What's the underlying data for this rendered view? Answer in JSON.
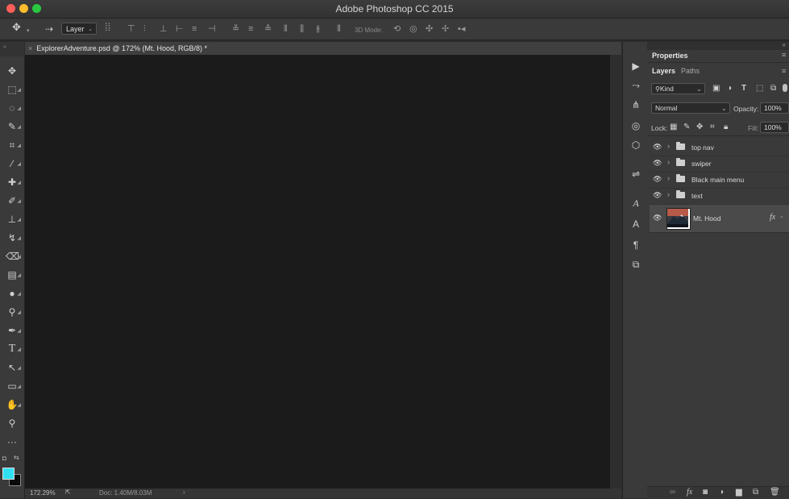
{
  "window": {
    "title": "Adobe Photoshop CC 2015",
    "traffic_colors": [
      "#fc5f57",
      "#fdbc2e",
      "#29c840"
    ]
  },
  "options_bar": {
    "move_icon": "move-tool-icon",
    "target_select": "Layer",
    "mode_label": "3D Mode:"
  },
  "document": {
    "tab_title": "ExplorerAdventure.psd @ 172% (Mt. Hood, RGB/8) *",
    "zoom": "172.29%",
    "doc_info": "Doc: 1.40M/8.03M"
  },
  "toolbox": {
    "tools": [
      {
        "name": "move-tool",
        "glyph": "✥"
      },
      {
        "name": "marquee-tool",
        "glyph": "⬚"
      },
      {
        "name": "lasso-tool",
        "glyph": "◌"
      },
      {
        "name": "quick-select-tool",
        "glyph": "✎"
      },
      {
        "name": "crop-tool",
        "glyph": "⌗"
      },
      {
        "name": "eyedropper-tool",
        "glyph": "⁄"
      },
      {
        "name": "healing-brush-tool",
        "glyph": "✚"
      },
      {
        "name": "brush-tool",
        "glyph": "✐"
      },
      {
        "name": "stamp-tool",
        "glyph": "⊥"
      },
      {
        "name": "history-brush-tool",
        "glyph": "↯"
      },
      {
        "name": "eraser-tool",
        "glyph": "⌫"
      },
      {
        "name": "gradient-tool",
        "glyph": "▤"
      },
      {
        "name": "blur-tool",
        "glyph": "●"
      },
      {
        "name": "dodge-tool",
        "glyph": "⚲"
      },
      {
        "name": "pen-tool",
        "glyph": "✒"
      },
      {
        "name": "type-tool",
        "glyph": "T"
      },
      {
        "name": "path-select-tool",
        "glyph": "↖"
      },
      {
        "name": "rectangle-tool",
        "glyph": "▭"
      },
      {
        "name": "hand-tool",
        "glyph": "✋"
      },
      {
        "name": "zoom-tool",
        "glyph": "⚲"
      },
      {
        "name": "more-tools",
        "glyph": "···"
      }
    ],
    "foreground_color": "#2fe0f2",
    "background_color": "#0a0a0a"
  },
  "panels": {
    "properties_label": "Properties",
    "layers_tab": "Layers",
    "paths_tab": "Paths",
    "kind_filter": "Kind",
    "blend_mode": "Normal",
    "opacity_label": "Opacity:",
    "opacity_value": "100%",
    "lock_label": "Lock:",
    "fill_label": "Fill:",
    "fill_value": "100%",
    "layers": [
      {
        "name": "top nav",
        "type": "group"
      },
      {
        "name": "swiper",
        "type": "group"
      },
      {
        "name": "Black main menu",
        "type": "group"
      },
      {
        "name": "text",
        "type": "group"
      },
      {
        "name": "Mt. Hood",
        "type": "image",
        "fx": "fx"
      }
    ]
  }
}
